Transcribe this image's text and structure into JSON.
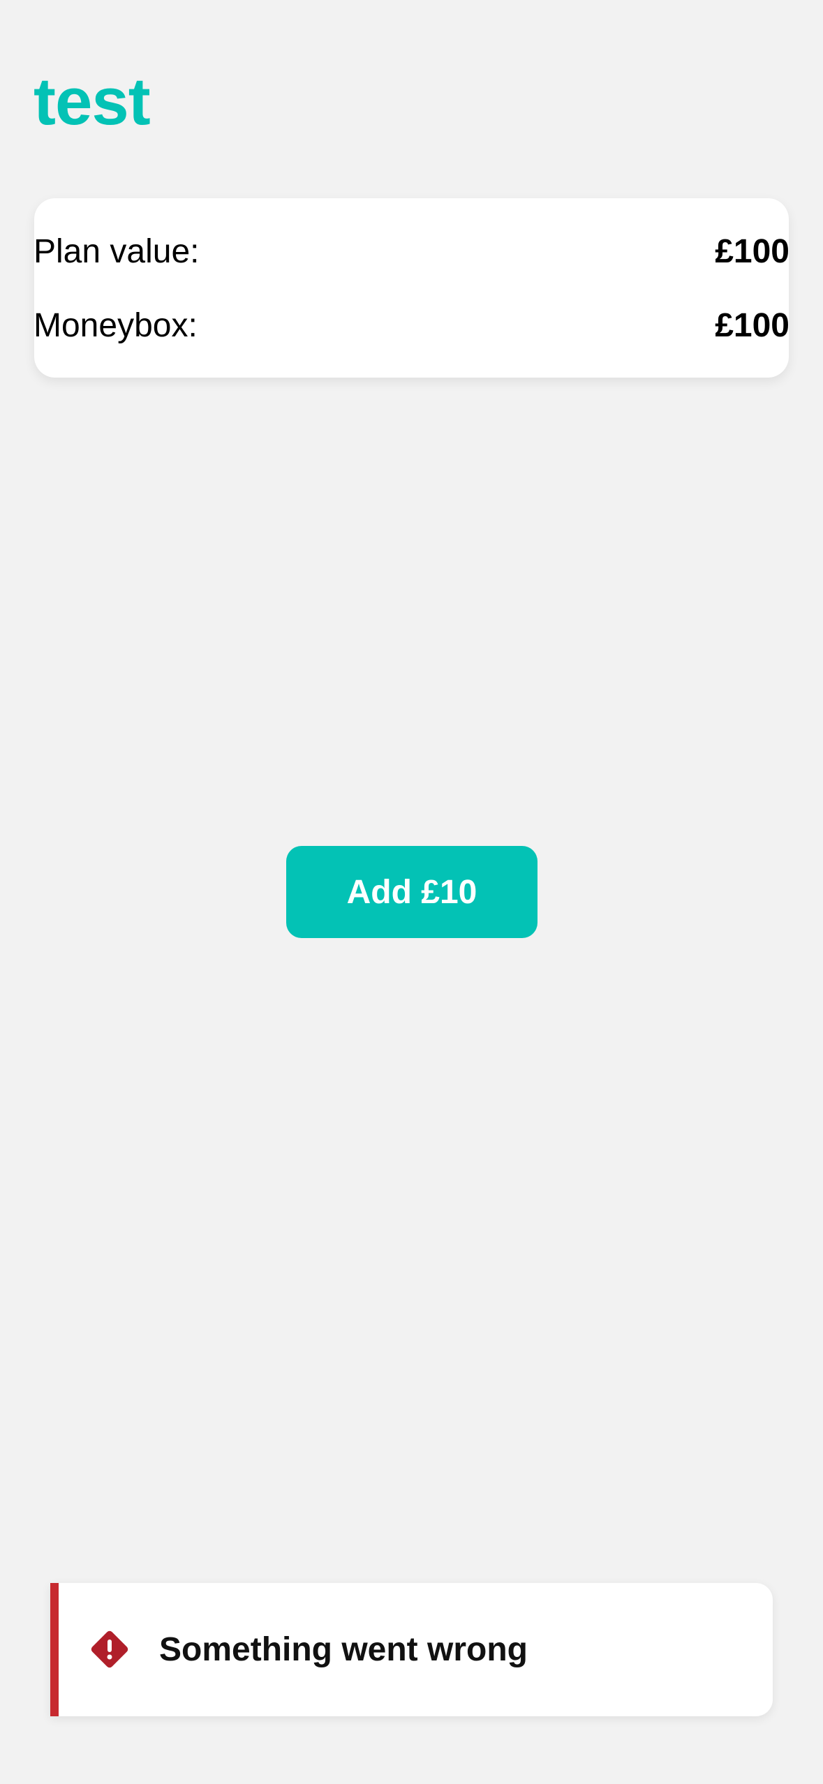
{
  "header": {
    "title": "test",
    "title_color": "#03c2b5"
  },
  "summary": {
    "plan_value_label": "Plan value:",
    "plan_value": "£100",
    "moneybox_label": "Moneybox:",
    "moneybox_value": "£100"
  },
  "actions": {
    "add_label": "Add £10",
    "accent_color": "#03c2b5"
  },
  "toast": {
    "message": "Something went wrong",
    "icon": "error-diamond-icon",
    "status_color": "#c7292f"
  }
}
